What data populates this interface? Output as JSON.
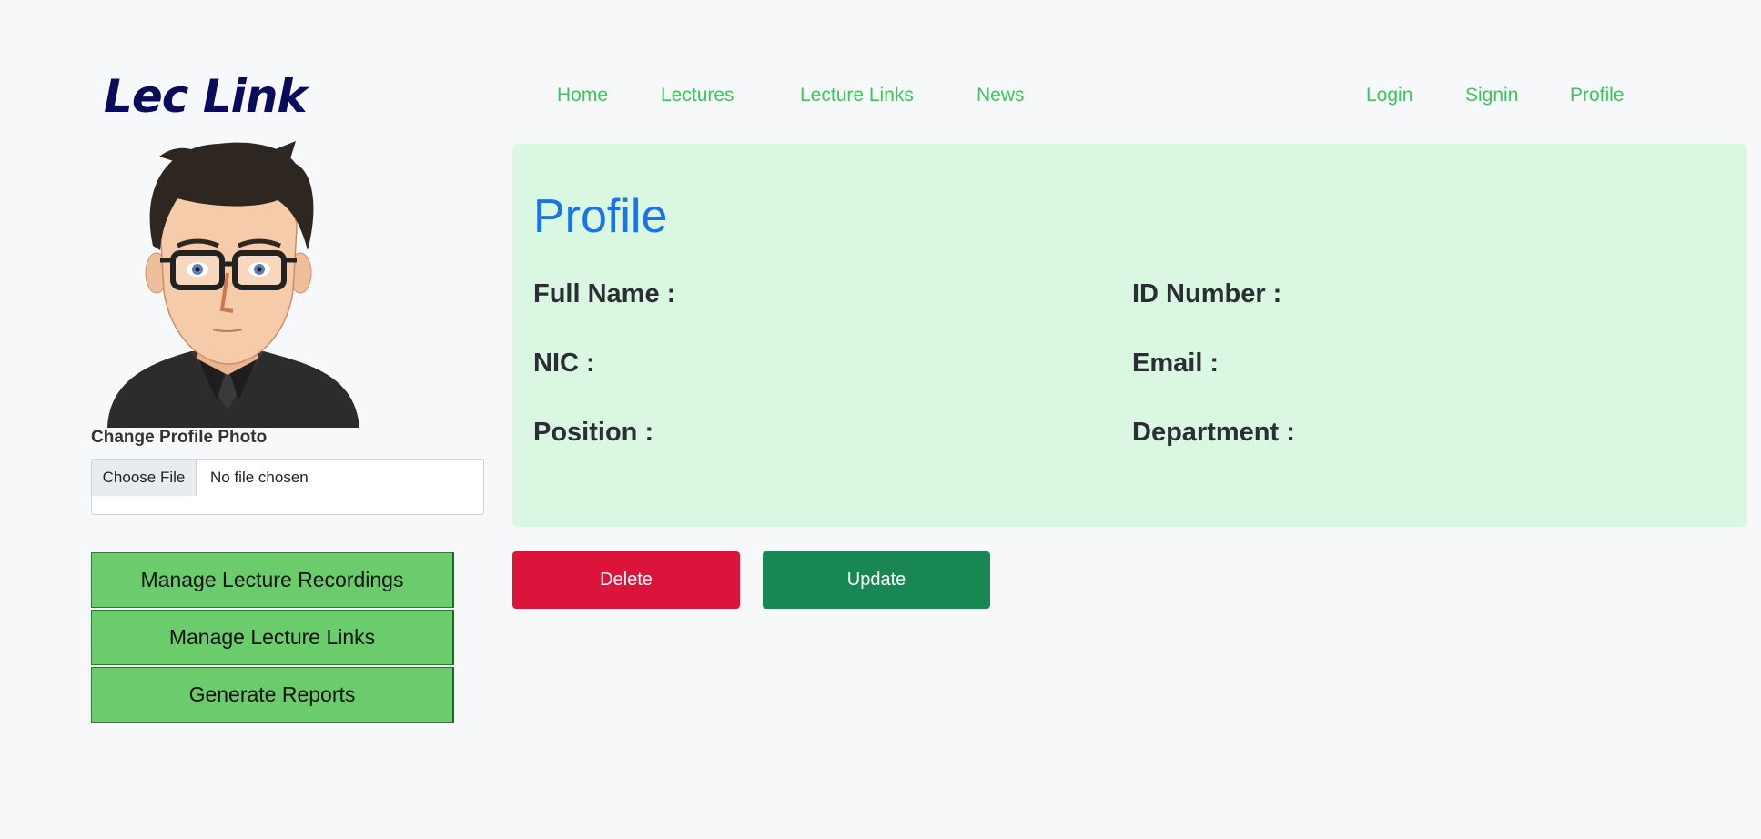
{
  "brand": {
    "name": "Lec Link",
    "color": "#0b0b5c"
  },
  "nav": {
    "left": [
      "Home",
      "Lectures",
      "Lecture Links",
      "News"
    ],
    "right": [
      "Login",
      "Signin",
      "Profile"
    ],
    "color": "#3ec45b"
  },
  "sidebar": {
    "avatar": "avatar-cartoon-man",
    "photo_label": "Change Profile Photo",
    "file_button": "Choose File",
    "file_status": "No file chosen",
    "menu": [
      "Manage Lecture Recordings",
      "Manage Lecture Links",
      "Generate Reports"
    ],
    "menu_color": "#6bcc6b"
  },
  "profile": {
    "title": "Profile",
    "fields": {
      "full_name": "Full Name :",
      "id_number": "ID Number :",
      "nic": "NIC :",
      "email": "Email :",
      "position": "Position :",
      "department": "Department :"
    },
    "panel_color": "#daf7e2",
    "title_color": "#1a73e8"
  },
  "actions": {
    "delete": "Delete",
    "update": "Update",
    "delete_color": "#dc143c",
    "update_color": "#198754"
  }
}
